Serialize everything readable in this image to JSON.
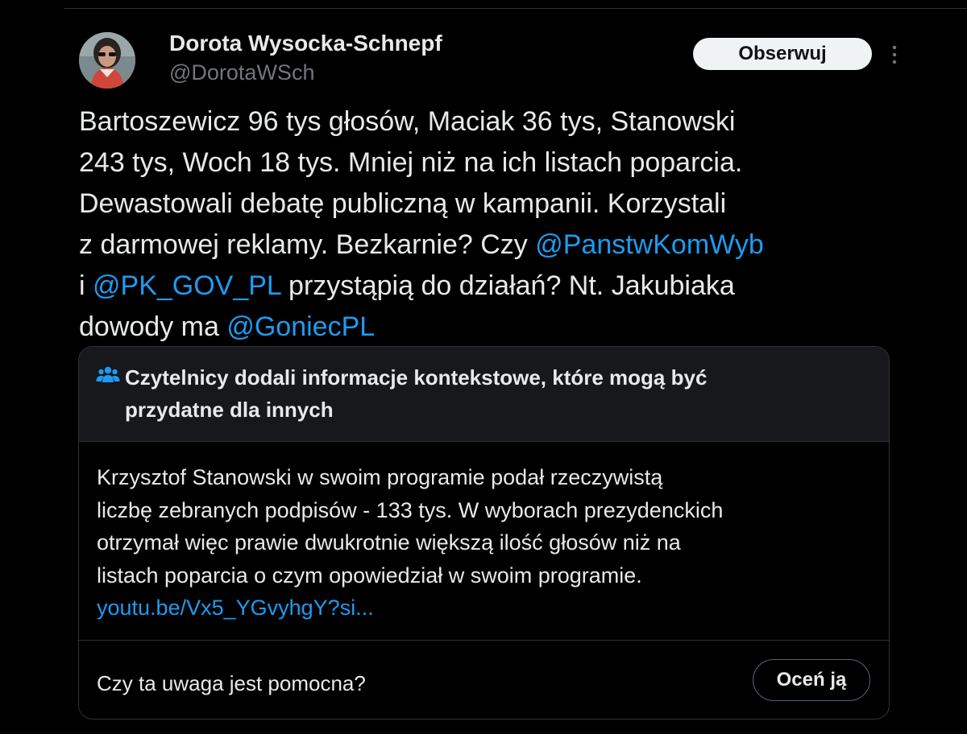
{
  "author": {
    "name": "Dorota Wysocka-Schnepf",
    "handle": "@DorotaWSch"
  },
  "follow_button_label": "Obserwuj",
  "tweet": {
    "lines": [
      [
        {
          "text": "Bartoszewicz 96 tys głosów, Maciak 36 tys, Stanowski",
          "mention": false
        }
      ],
      [
        {
          "text": "243 tys, Woch 18 tys. Mniej niż na ich listach poparcia.",
          "mention": false
        }
      ],
      [
        {
          "text": "Dewastowali debatę publiczną w kampanii. Korzystali",
          "mention": false
        }
      ],
      [
        {
          "text": "z darmowej reklamy. Bezkarnie? Czy ",
          "mention": false
        },
        {
          "text": "@PanstwKomWyb",
          "mention": true
        }
      ],
      [
        {
          "text": "i ",
          "mention": false
        },
        {
          "text": "@PK_GOV_PL",
          "mention": true
        },
        {
          "text": " przystąpią do działań? Nt. Jakubiaka",
          "mention": false
        }
      ],
      [
        {
          "text": "dowody ma ",
          "mention": false
        },
        {
          "text": "@GoniecPL",
          "mention": true
        }
      ]
    ]
  },
  "community_note": {
    "title_lines": [
      "Czytelnicy dodali informacje kontekstowe, które mogą być",
      "przydatne dla innych"
    ],
    "body_lines": [
      "Krzysztof Stanowski w swoim programie podał rzeczywistą",
      "liczbę zebranych podpisów - 133 tys. W wyborach prezydenckich",
      "otrzymał więc prawie dwukrotnie większą ilość głosów niż na",
      "listach poparcia o czym opowiedział w swoim programie."
    ],
    "link": "youtu.be/Vx5_YGvyhgY?si...",
    "helpful_question": "Czy ta uwaga jest pomocna?",
    "rate_button_label": "Oceń ją"
  },
  "colors": {
    "background": "#000000",
    "text": "#e7e9ea",
    "secondary_text": "#71767b",
    "link": "#1d9bf0",
    "note_header_bg": "#16181c",
    "border": "#2f3336"
  },
  "icons": {
    "more": "more-vertical-icon",
    "note": "people-icon"
  }
}
